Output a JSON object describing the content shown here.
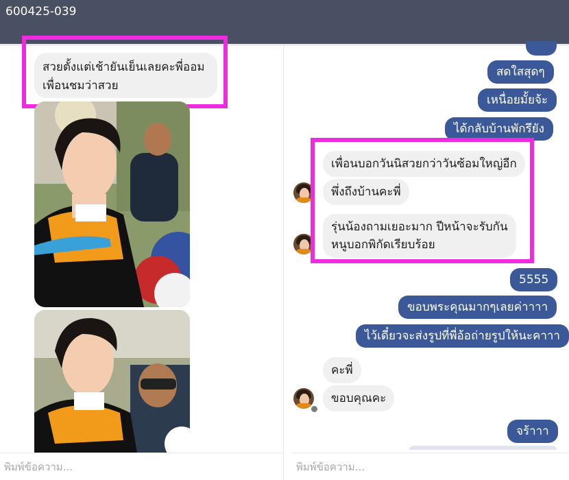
{
  "window": {
    "title": "600425-039"
  },
  "left_panel": {
    "message": "สวยตั้งแต่เช้ายันเย็นเลยคะพี่ออม\nเพื่อนชมว่าสวย",
    "composer_placeholder": "พิมพ์ข้อความ..."
  },
  "right_panel": {
    "outgoing_top": [
      "สดใสสุดๆ",
      "เหนื่อยมั้ยจ้ะ",
      "ได้กลับบ้านพักรึยัง"
    ],
    "incoming_group1": [
      "เพื่อนบอกวันนิสวยกว่าวันซ้อมใหญ่อีก",
      "พึ่งถึงบ้านคะพี่",
      "รุ่นน้องถามเยอะมาก ปีหน้าจะรับกัน\nหนูบอกพิกัดเรียบร้อย"
    ],
    "outgoing_mid": [
      "5555",
      "ขอบพระคุณมากๆเลยค่าาาา",
      "ไว้เดี๋ยวจะส่งรูปที่พี่อ้อถ่ายรูปให้นะคาาา"
    ],
    "incoming_group2": [
      "คะพี่",
      "ขอบคุณคะ"
    ],
    "outgoing_bottom": [
      "จร้าาา"
    ],
    "composer_placeholder": "พิมพ์ข้อความ..."
  },
  "colors": {
    "topbar": "#4a5063",
    "outgoing_bubble": "#3b5998",
    "incoming_bubble": "#f0f0f0",
    "highlight": "#ee2be0"
  }
}
